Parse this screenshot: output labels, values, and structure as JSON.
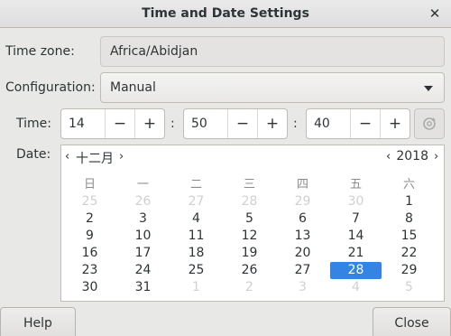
{
  "window": {
    "title": "Time and Date Settings",
    "close_glyph": "✕"
  },
  "timezone": {
    "label": "Time zone:",
    "value": "Africa/Abidjan"
  },
  "configuration": {
    "label": "Configuration:",
    "value": "Manual"
  },
  "time": {
    "label": "Time:",
    "hours": "14",
    "minutes": "50",
    "seconds": "40",
    "minus": "−",
    "plus": "+",
    "separator": ":"
  },
  "date": {
    "label": "Date:",
    "month": "十二月",
    "year": "2018",
    "prev": "‹",
    "next": "›",
    "weekdays": [
      "日",
      "一",
      "二",
      "三",
      "四",
      "五",
      "六"
    ],
    "weeks": [
      [
        {
          "d": "25",
          "o": true
        },
        {
          "d": "26",
          "o": true
        },
        {
          "d": "27",
          "o": true
        },
        {
          "d": "28",
          "o": true
        },
        {
          "d": "29",
          "o": true
        },
        {
          "d": "30",
          "o": true
        },
        {
          "d": "1"
        }
      ],
      [
        {
          "d": "2"
        },
        {
          "d": "3"
        },
        {
          "d": "4"
        },
        {
          "d": "5"
        },
        {
          "d": "6"
        },
        {
          "d": "7"
        },
        {
          "d": "8"
        }
      ],
      [
        {
          "d": "9"
        },
        {
          "d": "10"
        },
        {
          "d": "11"
        },
        {
          "d": "12"
        },
        {
          "d": "13"
        },
        {
          "d": "14"
        },
        {
          "d": "15"
        }
      ],
      [
        {
          "d": "16"
        },
        {
          "d": "17"
        },
        {
          "d": "18"
        },
        {
          "d": "19"
        },
        {
          "d": "20"
        },
        {
          "d": "21"
        },
        {
          "d": "22"
        }
      ],
      [
        {
          "d": "23"
        },
        {
          "d": "24"
        },
        {
          "d": "25"
        },
        {
          "d": "26"
        },
        {
          "d": "27"
        },
        {
          "d": "28",
          "s": true
        },
        {
          "d": "29"
        }
      ],
      [
        {
          "d": "30"
        },
        {
          "d": "31"
        },
        {
          "d": "1",
          "o": true
        },
        {
          "d": "2",
          "o": true
        },
        {
          "d": "3",
          "o": true
        },
        {
          "d": "4",
          "o": true
        },
        {
          "d": "5",
          "o": true
        }
      ]
    ]
  },
  "buttons": {
    "help": "Help",
    "close": "Close"
  },
  "colors": {
    "accent": "#3584e4"
  }
}
